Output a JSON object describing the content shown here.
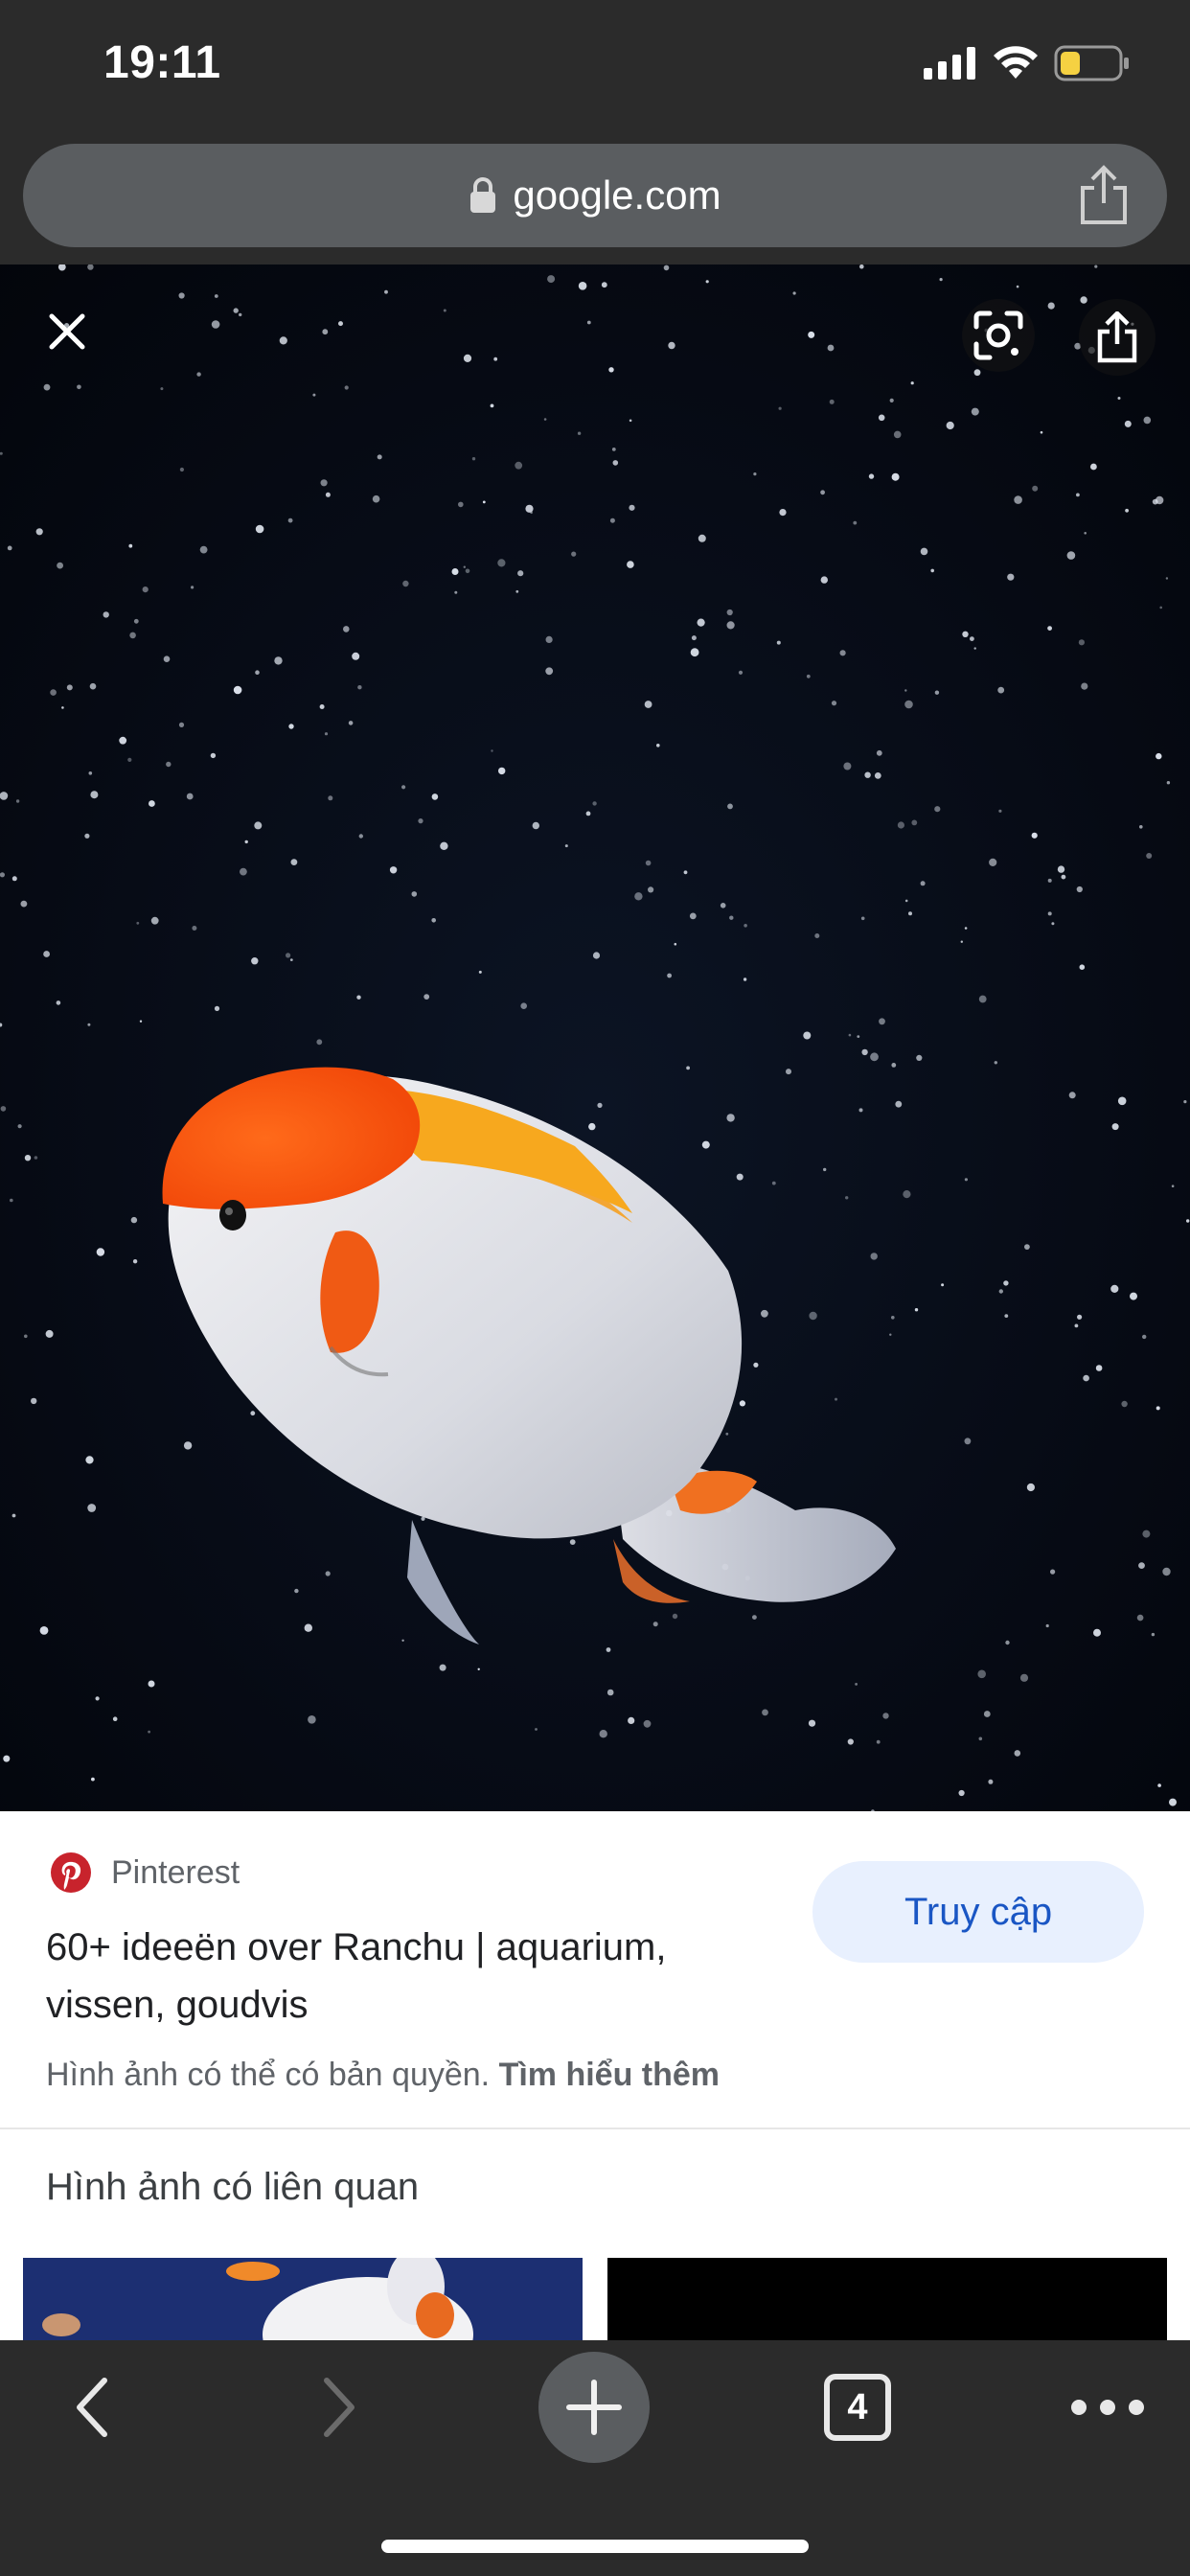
{
  "status_bar": {
    "time": "19:11",
    "icons": [
      "cellular-signal-icon",
      "wifi-icon",
      "battery-low-icon"
    ],
    "battery_color": "#f5d142"
  },
  "browser": {
    "url": "google.com",
    "icons": [
      "lock-icon",
      "share-icon"
    ]
  },
  "viewer": {
    "buttons": [
      "close-icon",
      "google-lens-icon",
      "share-icon"
    ],
    "image_subject": "goldfish"
  },
  "result": {
    "source": "Pinterest",
    "title": "60+ ideeën over Ranchu | aquarium, vissen, goudvis",
    "visit_label": "Truy cập",
    "copyright_text": "Hình ảnh có thể có bản quyền.",
    "learn_more": "Tìm hiểu thêm",
    "related_heading": "Hình ảnh có liên quan",
    "colors": {
      "visit_bg": "#e8f0fe",
      "visit_text": "#1a56c4",
      "pinterest": "#c8232c"
    }
  },
  "toolbar": {
    "tab_count": "4",
    "icons": [
      "back-icon",
      "forward-icon",
      "new-tab-icon",
      "tabs-icon",
      "more-icon"
    ]
  }
}
